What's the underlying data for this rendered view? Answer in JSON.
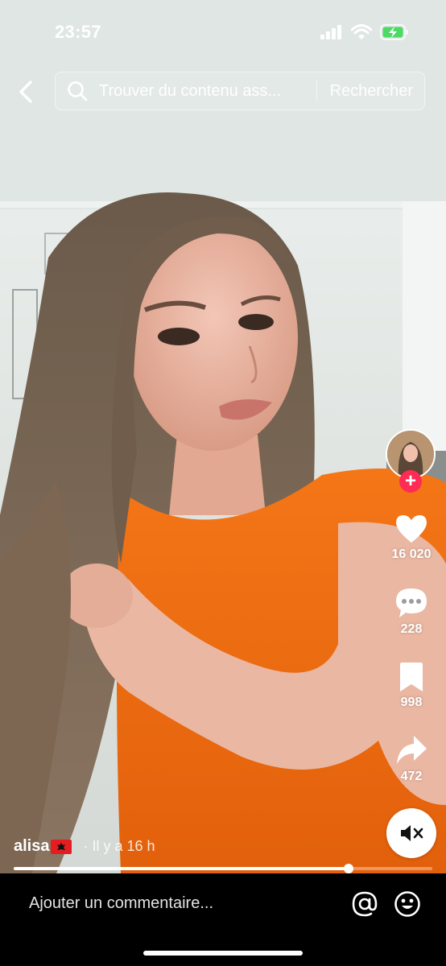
{
  "status_bar": {
    "time": "23:57",
    "signal_icon": "signal-bars-icon",
    "wifi_icon": "wifi-icon",
    "battery_icon": "battery-charging-icon"
  },
  "search": {
    "back_icon": "chevron-left-icon",
    "placeholder": "Trouver du contenu ass...",
    "submit_label": "Rechercher"
  },
  "actions": {
    "avatar_icon": "avatar",
    "follow_icon": "plus-icon",
    "follow_symbol": "+",
    "likes": "16 020",
    "comments": "228",
    "saves": "998",
    "shares": "472",
    "mute_icon": "speaker-muted-icon"
  },
  "caption": {
    "username": "alisa",
    "flag_icon": "albania-flag-icon",
    "time": "· Il y a 16 h"
  },
  "progress": {
    "played_fraction": 0.8
  },
  "comment_bar": {
    "placeholder": "Ajouter un commentaire...",
    "at_icon": "at-sign-icon",
    "emoji_icon": "emoji-icon"
  },
  "colors": {
    "accent": "#fe2c55",
    "shirt": "#f06a0f",
    "battery": "#4cd964"
  }
}
